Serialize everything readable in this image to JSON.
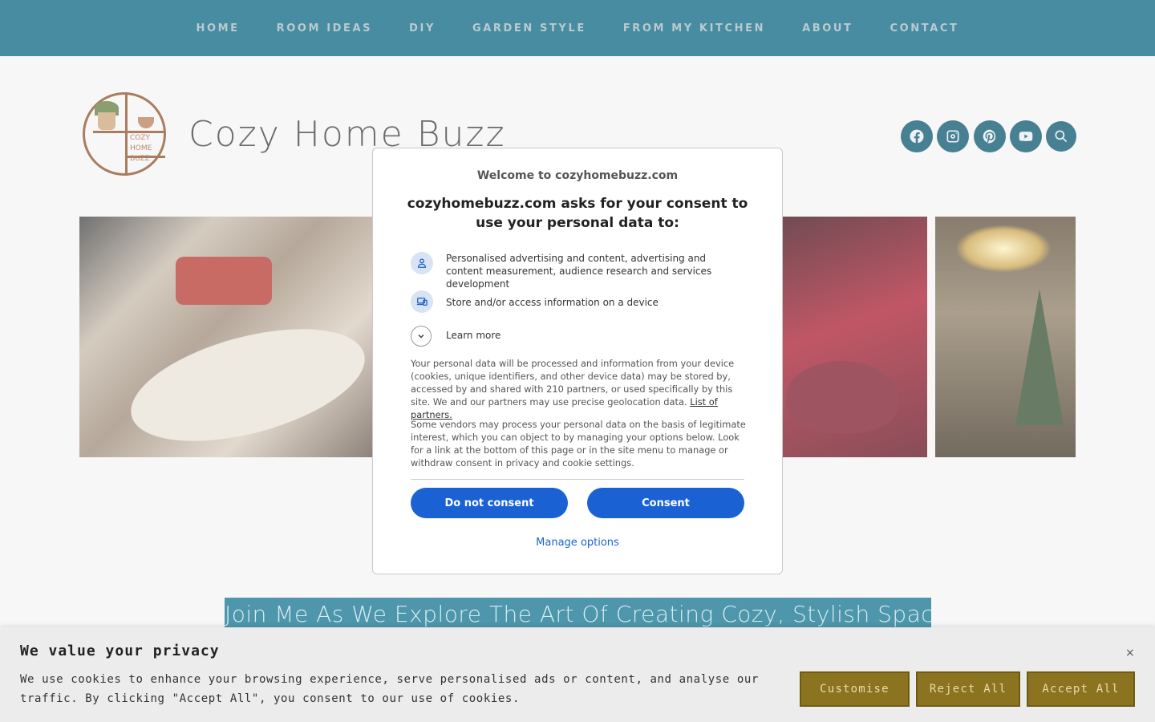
{
  "nav": {
    "items": [
      "HOME",
      "ROOM IDEAS",
      "DIY",
      "GARDEN STYLE",
      "FROM MY KITCHEN",
      "ABOUT",
      "CONTACT"
    ]
  },
  "header": {
    "logo_text": "COZY HOME BUZZ",
    "site_title": "Cozy Home Buzz",
    "social_icons": [
      "facebook-icon",
      "instagram-icon",
      "pinterest-icon",
      "youtube-icon",
      "search-icon"
    ]
  },
  "tagline": "Join Me As We Explore The Art Of Creating Cozy, Stylish Spaces",
  "consent_modal": {
    "welcome": "Welcome to cozyhomebuzz.com",
    "title": "cozyhomebuzz.com asks for your consent to use your personal data to:",
    "purposes": [
      {
        "icon": "person-icon",
        "text": "Personalised advertising and content, advertising and content measurement, audience research and services development"
      },
      {
        "icon": "device-icon",
        "text": "Store and/or access information on a device"
      }
    ],
    "learn_more": "Learn more",
    "paragraph1": "Your personal data will be processed and information from your device (cookies, unique identifiers, and other device data) may be stored by, accessed by and shared with 210 partners, or used specifically by this site. We and our partners may use precise geolocation data.",
    "partners_link": "List of partners.",
    "paragraph2": "Some vendors may process your personal data on the basis of legitimate interest, which you can object to by managing your options below. Look for a link at the bottom of this page or in the site menu to manage or withdraw consent in privacy and cookie settings.",
    "do_not_consent": "Do not consent",
    "consent": "Consent",
    "manage_options": "Manage options"
  },
  "cookie_banner": {
    "title": "We value your privacy",
    "text": "We use cookies to enhance your browsing experience, serve personalised ads or content, and analyse our traffic. By clicking \"Accept All\", you consent to our use of cookies.",
    "close": "×",
    "customise": "Customise",
    "reject_all": "Reject All",
    "accept_all": "Accept All"
  },
  "colors": {
    "nav_bg": "#01607c",
    "social_bg": "#01506a",
    "modal_button": "#1a62d4",
    "cookie_button": "#8b7320"
  }
}
